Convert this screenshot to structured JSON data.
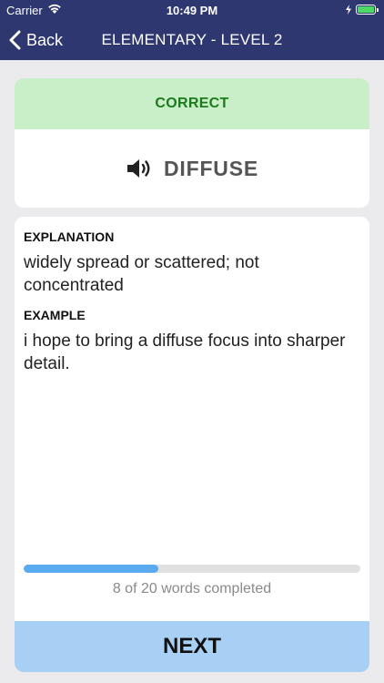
{
  "status_bar": {
    "carrier": "Carrier",
    "time": "10:49 PM",
    "battery_level": 1.0
  },
  "nav": {
    "back_label": "Back",
    "title": "ELEMENTARY - LEVEL 2"
  },
  "quiz": {
    "result": "CORRECT",
    "word": "DIFFUSE",
    "speaker_icon": "speaker-icon"
  },
  "detail": {
    "explanation_label": "EXPLANATION",
    "explanation_text": "widely spread or scattered; not concentrated",
    "example_label": "EXAMPLE",
    "example_text": "i hope to bring a diffuse focus into sharper detail."
  },
  "progress": {
    "completed": 8,
    "total": 20,
    "text": "8 of 20 words completed"
  },
  "footer": {
    "next_label": "NEXT"
  },
  "colors": {
    "nav_bg": "#2f3770",
    "correct_bg": "#c8efc7",
    "correct_text": "#1c7a1c",
    "progress_fill": "#5aaaf0",
    "next_bg": "#a8d0f5"
  }
}
